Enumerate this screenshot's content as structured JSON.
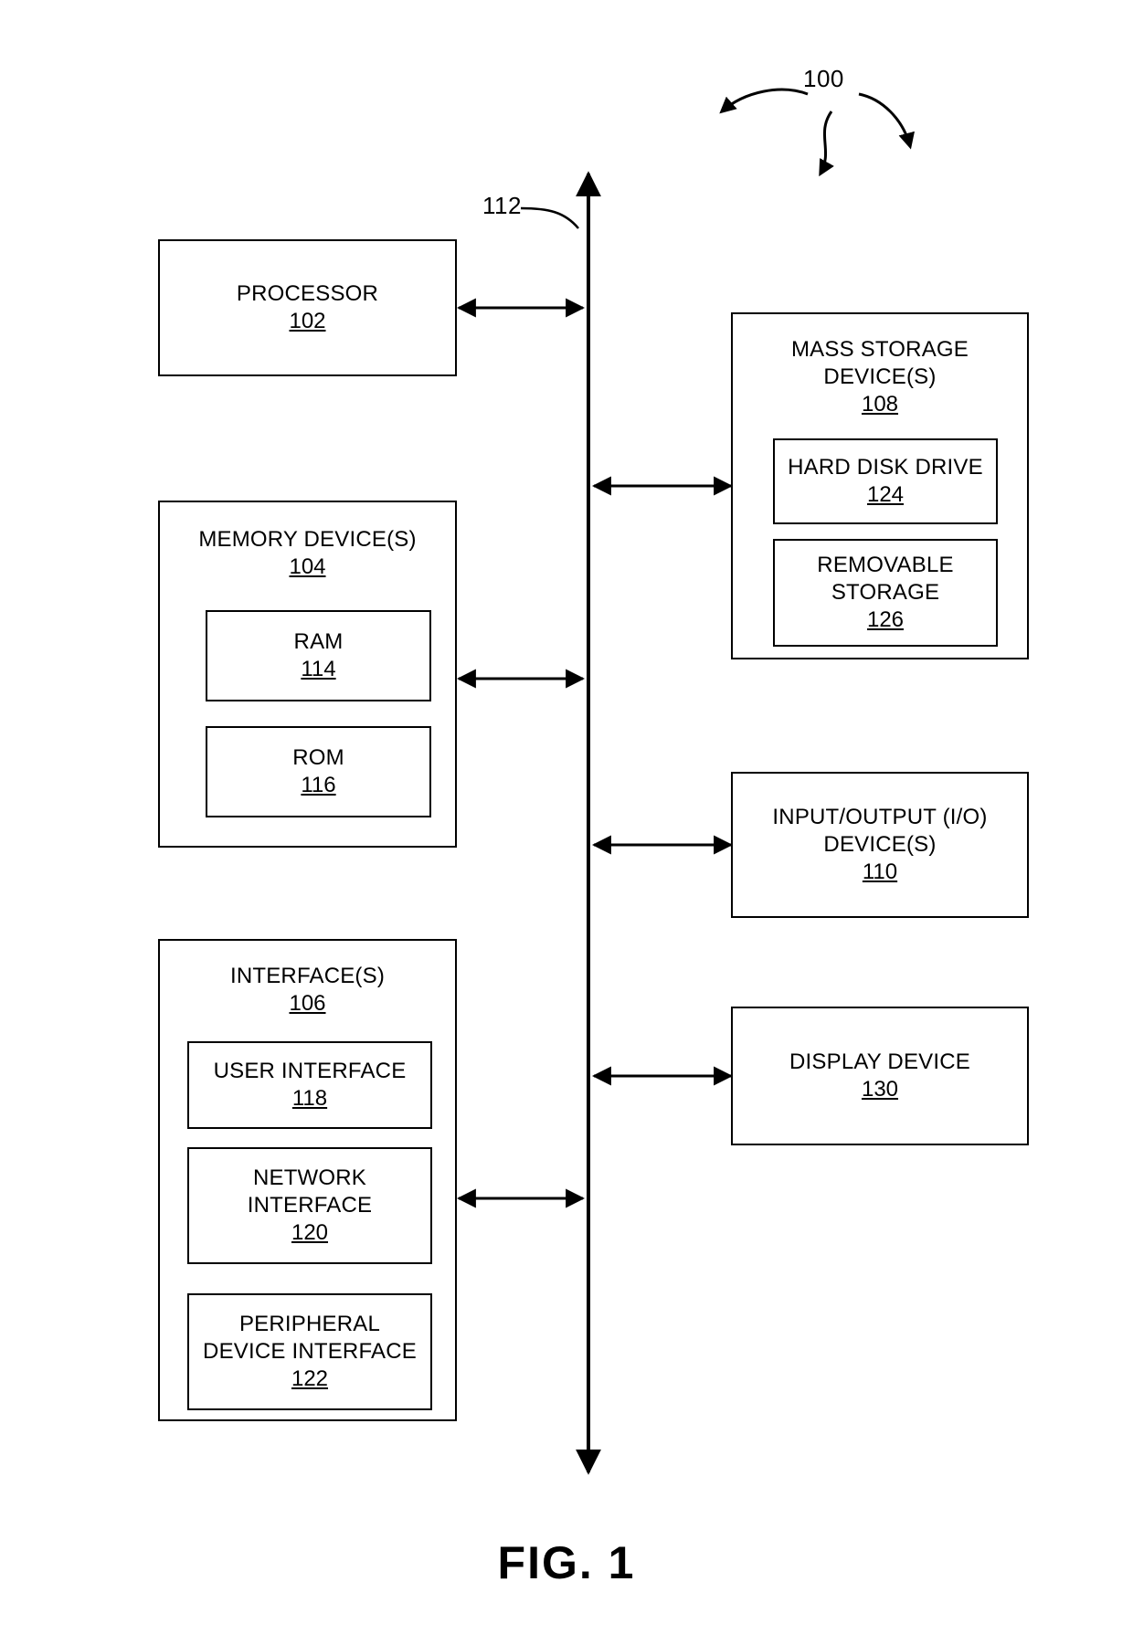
{
  "figure": {
    "caption": "FIG. 1",
    "system_ref": "100",
    "bus_ref": "112"
  },
  "left_column": {
    "processor": {
      "title": "PROCESSOR",
      "number": "102"
    },
    "memory": {
      "title": "MEMORY DEVICE(S)",
      "number": "104",
      "children": [
        {
          "title": "RAM",
          "number": "114"
        },
        {
          "title": "ROM",
          "number": "116"
        }
      ]
    },
    "interfaces": {
      "title": "INTERFACE(S)",
      "number": "106",
      "children": [
        {
          "title": "USER INTERFACE",
          "number": "118"
        },
        {
          "title": "NETWORK\nINTERFACE",
          "number": "120"
        },
        {
          "title": "PERIPHERAL\nDEVICE INTERFACE",
          "number": "122"
        }
      ]
    }
  },
  "right_column": {
    "mass_storage": {
      "title": "MASS STORAGE\nDEVICE(S)",
      "number": "108",
      "children": [
        {
          "title": "HARD DISK DRIVE",
          "number": "124"
        },
        {
          "title": "REMOVABLE\nSTORAGE",
          "number": "126"
        }
      ]
    },
    "io": {
      "title": "INPUT/OUTPUT (I/O)\nDEVICE(S)",
      "number": "110"
    },
    "display": {
      "title": "DISPLAY DEVICE",
      "number": "130"
    }
  },
  "colors": {
    "line": "#000000",
    "background": "#ffffff"
  }
}
